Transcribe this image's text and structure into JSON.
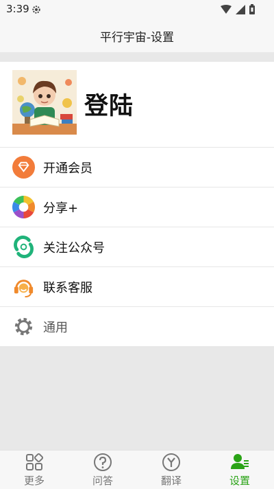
{
  "status": {
    "time": "3:39"
  },
  "header": {
    "title": "平行宇宙-设置"
  },
  "profile": {
    "login_label": "登陆"
  },
  "menu": [
    {
      "label": "开通会员",
      "icon": "diamond-icon"
    },
    {
      "label": "分享+",
      "icon": "aperture-icon"
    },
    {
      "label": "关注公众号",
      "icon": "wechat-official-icon"
    },
    {
      "label": "联系客服",
      "icon": "headset-icon"
    },
    {
      "label": "通用",
      "icon": "gear-icon"
    }
  ],
  "nav": [
    {
      "label": "更多",
      "icon": "grid-icon"
    },
    {
      "label": "问答",
      "icon": "question-icon"
    },
    {
      "label": "翻译",
      "icon": "translate-icon"
    },
    {
      "label": "设置",
      "icon": "person-settings-icon",
      "active": true
    }
  ],
  "colors": {
    "accent": "#2aa316",
    "background": "#e8e8e8"
  }
}
